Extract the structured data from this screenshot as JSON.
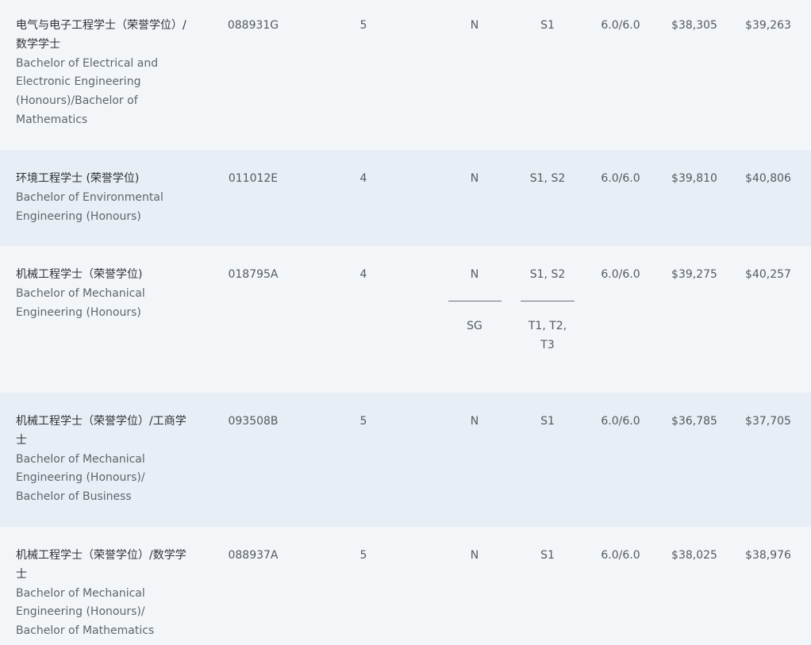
{
  "rows": [
    {
      "name_cn": "电气与电子工程学士（荣誉学位）/数学学士",
      "name_en": "Bachelor of Electrical and Electronic Engineering (Honours)/Bachelor of Mathematics",
      "code": "088931G",
      "years": "5",
      "flag": "N",
      "intake": "S1",
      "ielts": "6.0/6.0",
      "fee1": "$38,305",
      "fee2": "$39,263"
    },
    {
      "name_cn": "环境工程学士 (荣誉学位)",
      "name_en": "Bachelor of Environmental Engineering (Honours)",
      "code": "011012E",
      "years": "4",
      "flag": "N",
      "intake": "S1, S2",
      "ielts": "6.0/6.0",
      "fee1": "$39,810",
      "fee2": "$40,806"
    },
    {
      "name_cn": "机械工程学士（荣誉学位)",
      "name_en": "Bachelor of Mechanical Engineering (Honours)",
      "code": "018795A",
      "years": "4",
      "flag": "N",
      "intake": "S1, S2",
      "flag_alt": "SG",
      "intake_alt": "T1, T2, T3",
      "ielts": "6.0/6.0",
      "fee1": "$39,275",
      "fee2": "$40,257"
    },
    {
      "name_cn": "机械工程学士（荣誉学位）/工商学士",
      "name_en": "Bachelor of Mechanical Engineering (Honours)/ Bachelor of Business",
      "code": "093508B",
      "years": "5",
      "flag": "N",
      "intake": "S1",
      "ielts": "6.0/6.0",
      "fee1": "$36,785",
      "fee2": "$37,705"
    },
    {
      "name_cn": "机械工程学士（荣誉学位）/数学学士",
      "name_en": "Bachelor of Mechanical Engineering (Honours)/ Bachelor of Mathematics",
      "code": "088937A",
      "years": "5",
      "flag": "N",
      "intake": "S1",
      "ielts": "6.0/6.0",
      "fee1": "$38,025",
      "fee2": "$38,976"
    }
  ]
}
